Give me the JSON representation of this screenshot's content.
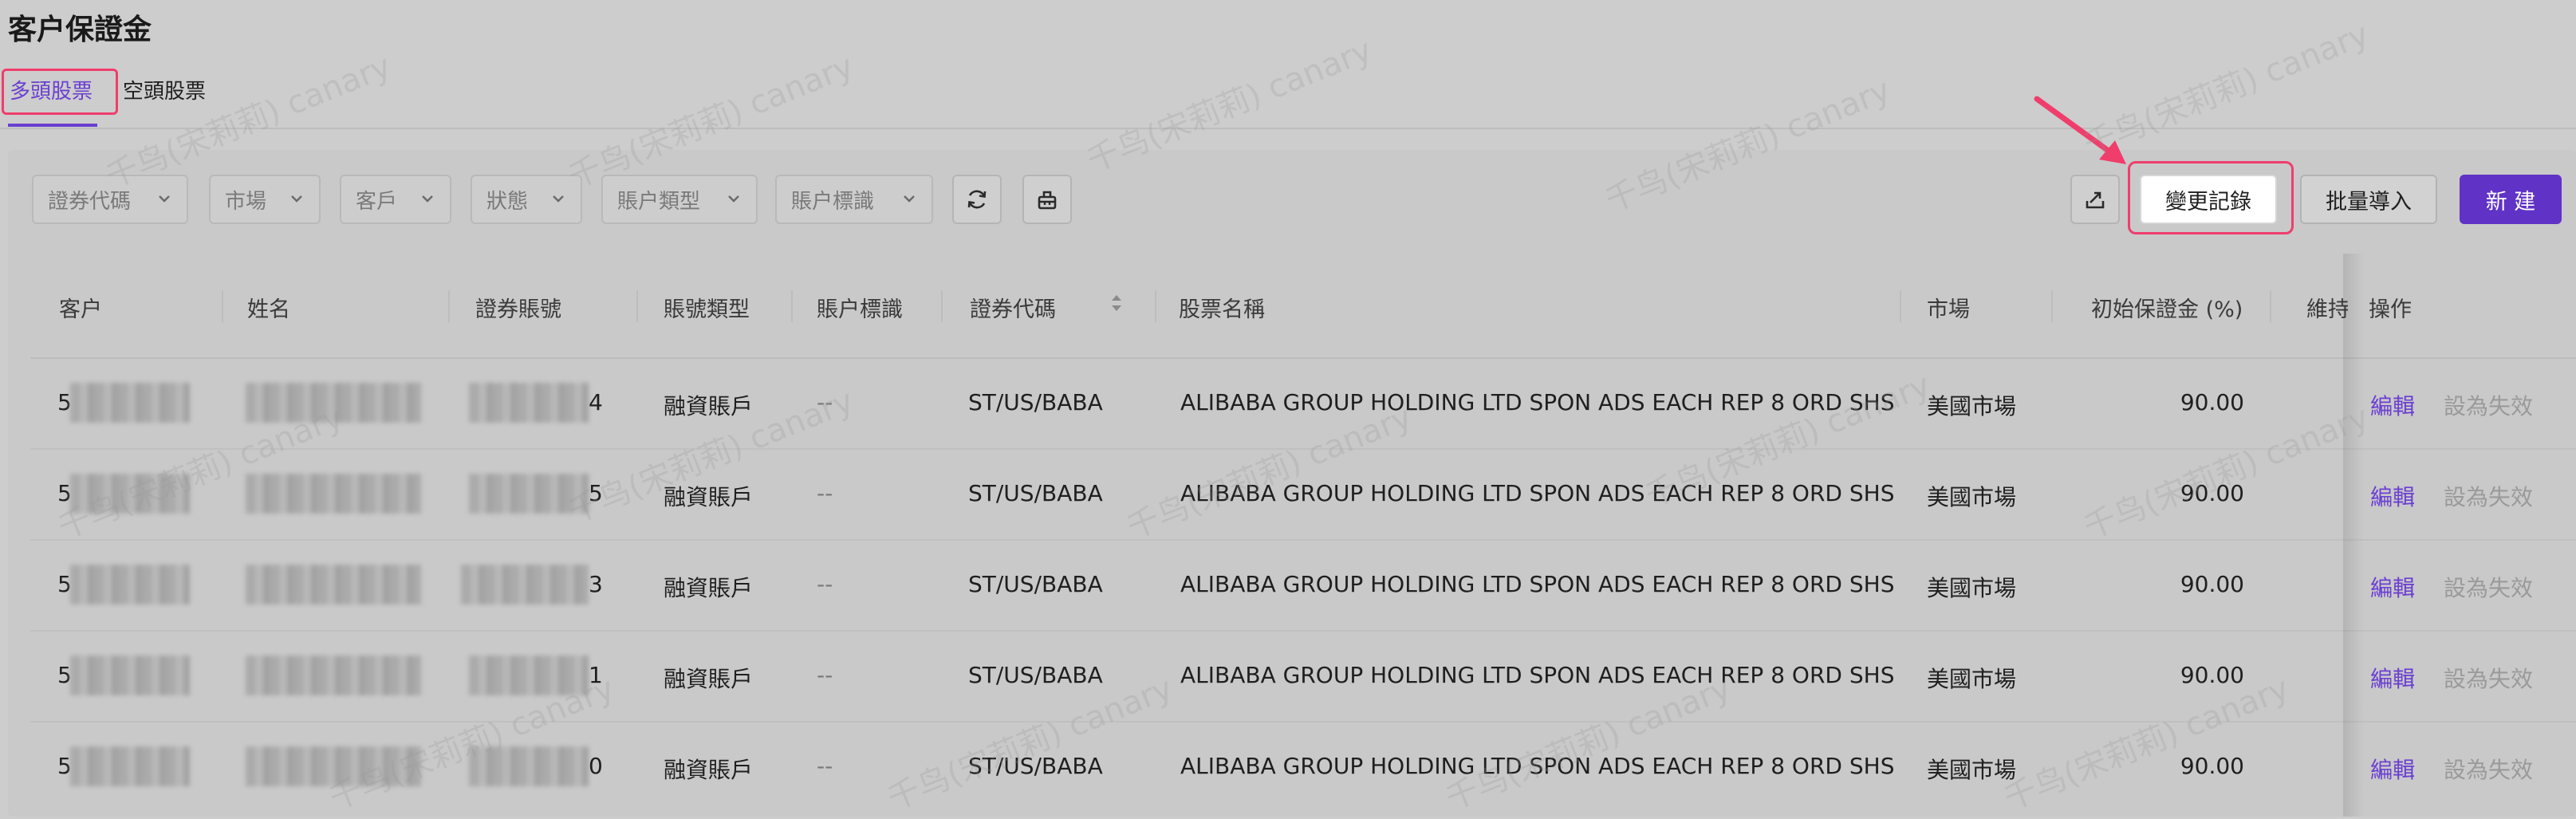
{
  "page": {
    "title": "客户保證金"
  },
  "tabs": [
    {
      "label": "多頭股票",
      "active": true
    },
    {
      "label": "空頭股票",
      "active": false
    }
  ],
  "filters": [
    {
      "placeholder": "證券代碼"
    },
    {
      "placeholder": "市場"
    },
    {
      "placeholder": "客戶"
    },
    {
      "placeholder": "狀態"
    },
    {
      "placeholder": "賬户類型"
    },
    {
      "placeholder": "賬户標識"
    }
  ],
  "toolbar": {
    "refresh_icon": "refresh-icon",
    "clear_icon": "clear-icon",
    "export_icon": "export-icon",
    "changelog_label": "變更記錄",
    "import_label": "批量導入",
    "new_label": "新 建"
  },
  "table": {
    "columns": [
      "客户",
      "姓名",
      "證券賬號",
      "賬號類型",
      "賬户標識",
      "證券代碼",
      "股票名稱",
      "市場",
      "初始保證金 (%)",
      "維持",
      "操作"
    ],
    "rows": [
      {
        "customer_prefix": "5",
        "account_suffix": "4",
        "account_type": "融資賬戶",
        "account_flag": "--",
        "code": "ST/US/BABA",
        "stock_name": "ALIBABA GROUP HOLDING LTD SPON ADS EACH REP 8 ORD SHS",
        "market": "美國市場",
        "initial_margin": "90.00",
        "edit": "編輯",
        "set_invalid": "設為失效"
      },
      {
        "customer_prefix": "5",
        "account_suffix": "5",
        "account_type": "融資賬戶",
        "account_flag": "--",
        "code": "ST/US/BABA",
        "stock_name": "ALIBABA GROUP HOLDING LTD SPON ADS EACH REP 8 ORD SHS",
        "market": "美國市場",
        "initial_margin": "90.00",
        "edit": "編輯",
        "set_invalid": "設為失效"
      },
      {
        "customer_prefix": "5",
        "account_suffix": "3",
        "account_type": "融資賬戶",
        "account_flag": "--",
        "code": "ST/US/BABA",
        "stock_name": "ALIBABA GROUP HOLDING LTD SPON ADS EACH REP 8 ORD SHS",
        "market": "美國市場",
        "initial_margin": "90.00",
        "edit": "編輯",
        "set_invalid": "設為失效"
      },
      {
        "customer_prefix": "5",
        "account_suffix": "1",
        "account_type": "融資賬戶",
        "account_flag": "--",
        "code": "ST/US/BABA",
        "stock_name": "ALIBABA GROUP HOLDING LTD SPON ADS EACH REP 8 ORD SHS",
        "market": "美國市場",
        "initial_margin": "90.00",
        "edit": "編輯",
        "set_invalid": "設為失效"
      },
      {
        "customer_prefix": "5",
        "account_suffix": "0",
        "account_type": "融資賬戶",
        "account_flag": "--",
        "code": "ST/US/BABA",
        "stock_name": "ALIBABA GROUP HOLDING LTD SPON ADS EACH REP 8 ORD SHS",
        "market": "美國市場",
        "initial_margin": "90.00",
        "edit": "編輯",
        "set_invalid": "設為失效"
      }
    ]
  },
  "watermark_text": "千鸟(宋莉莉) canary",
  "colors": {
    "accent": "#6b3fd1",
    "primary_button": "#6032c6",
    "highlight_box": "#ef3e6c",
    "overlay_bg": "#cdcdcd"
  }
}
